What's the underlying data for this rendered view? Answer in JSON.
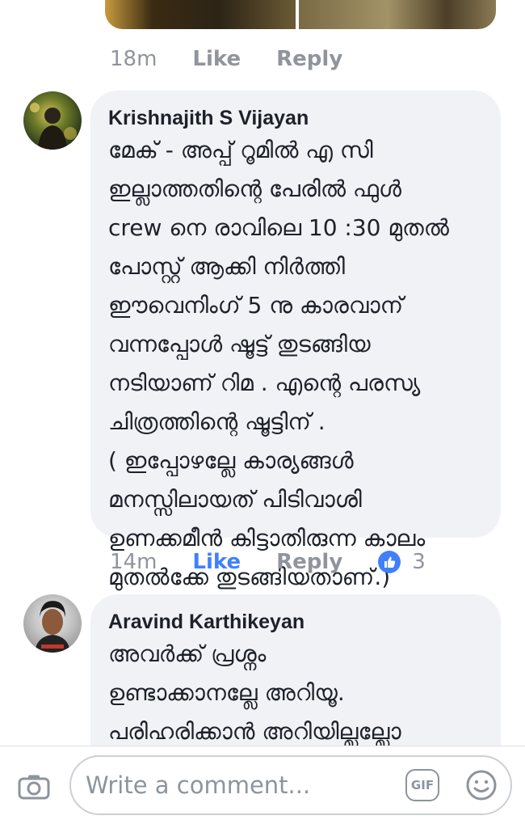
{
  "comment0": {
    "time": "18m",
    "like": "Like",
    "reply": "Reply"
  },
  "comment1": {
    "author": "Krishnajith S Vijayan",
    "text": "മേക് - അപ്പ് റൂമിൽ എ സി\nഇല്ലാത്തതിന്റെ പേരിൽ ഫുൾ\ncrew നെ രാവിലെ 10 :30 മുതൽ\nപോസ്റ്റ് ആക്കി നിർത്തി\nഈവെനിംഗ് 5 നു കാരവാന്\nവന്നപ്പോൾ ഷൂട്ട് തുടങ്ങിയ\nനടിയാണ് റിമ . എന്റെ പരസ്യ\nചിത്രത്തിന്റെ ഷൂട്ടിന് .\n( ഇപ്പോഴല്ലേ കാര്യങ്ങൾ\nമനസ്സിലായത് പിടിവാശി\nഉണക്കമീൻ കിട്ടാതിരുന്ന കാലം\nമുതൽക്കേ തുടങ്ങിയതാണ്.)",
    "time": "14m",
    "like": "Like",
    "reply": "Reply",
    "reaction_count": "3"
  },
  "comment2": {
    "author": "Aravind Karthikeyan",
    "text": "അവർക്ക് പ്രശ്നം\nഉണ്ടാക്കാനല്ലേ അറിയൂ.\nപരിഹരിക്കാൻ അറിയില്ലല്ലോ"
  },
  "composer": {
    "placeholder": "Write a comment...",
    "gif_label": "GIF",
    "icons": [
      "camera-icon",
      "gif-icon",
      "emoji-icon"
    ]
  },
  "colors": {
    "accent": "#4080ff",
    "meta": "#90949c",
    "bubble": "#f1f2f6"
  }
}
